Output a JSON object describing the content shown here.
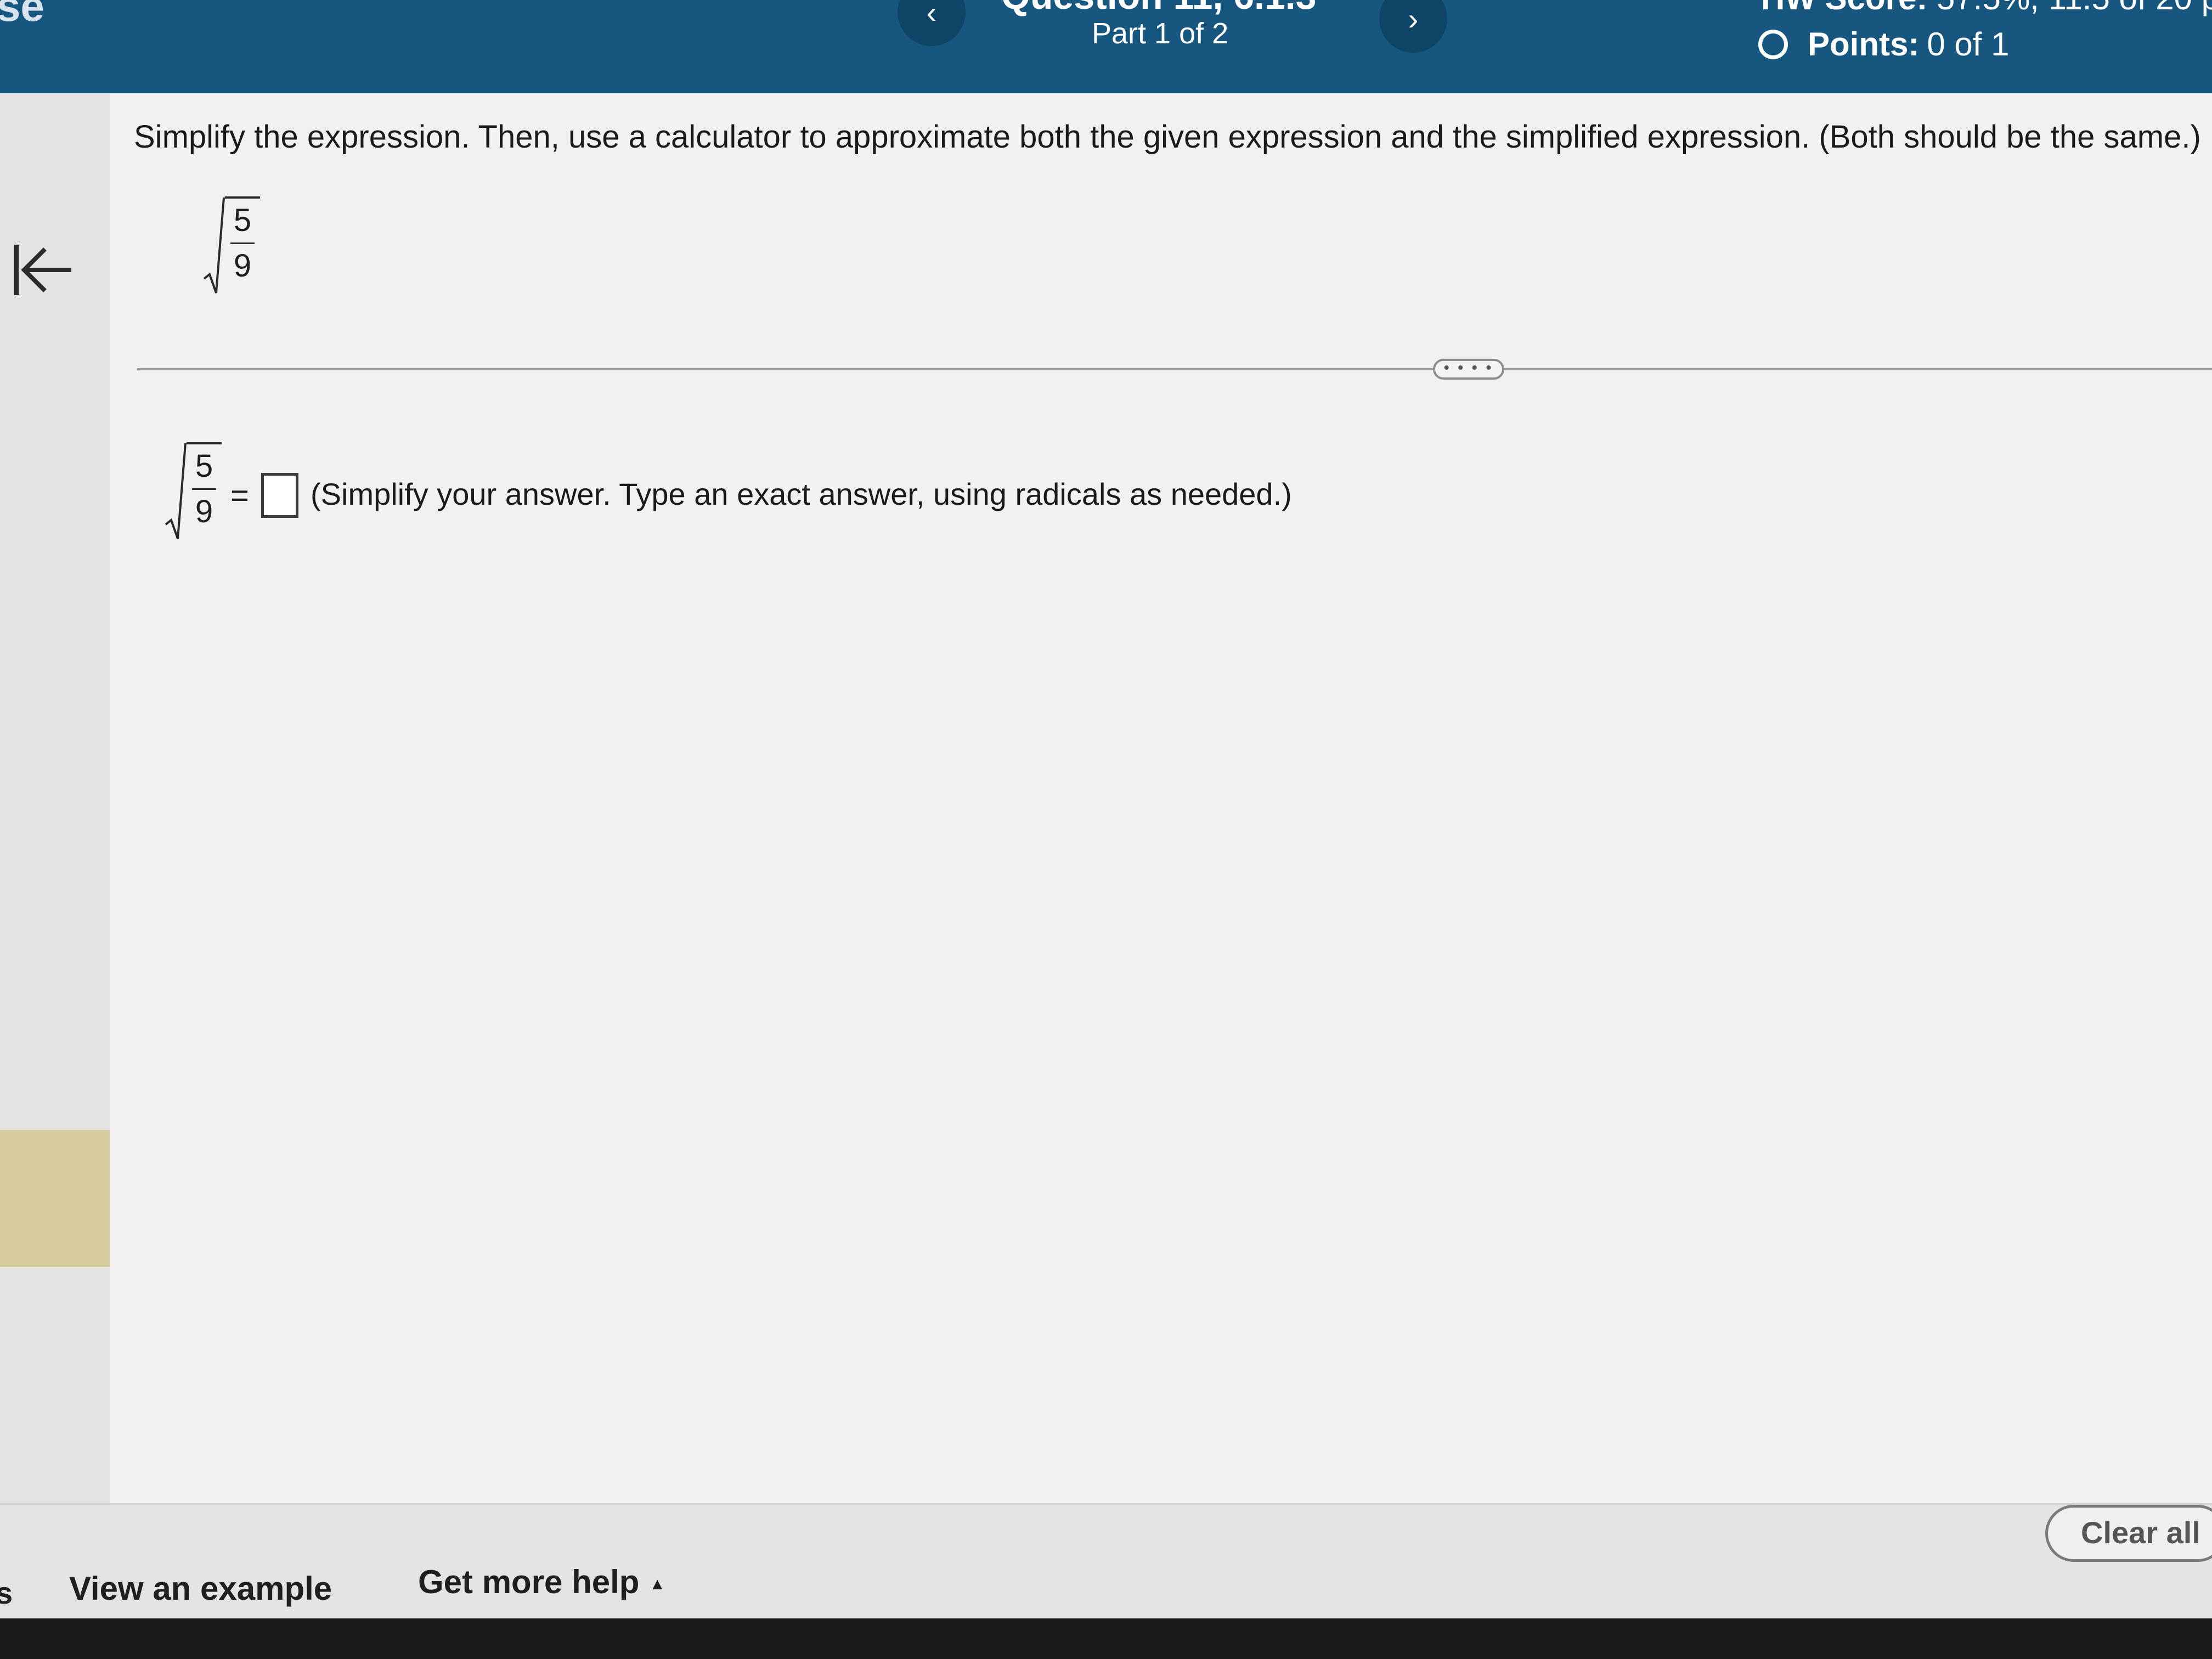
{
  "header": {
    "left_partial_text": "se",
    "question_label": "Question 11, 6.1.3",
    "part_label": "Part 1 of 2",
    "prev_glyph": "‹",
    "next_glyph": "›",
    "hw_score_label": "HW Score:",
    "hw_score_value": "57.5%, 11.5 of 20 p",
    "points_label": "Points:",
    "points_value": "0 of 1"
  },
  "question": {
    "prompt": "Simplify the expression. Then, use a calculator to approximate both the given expression and the simplified expression. (Both should be the same.)",
    "expression": {
      "numerator": "5",
      "denominator": "9"
    },
    "more_button": "• • • •"
  },
  "answer": {
    "expression": {
      "numerator": "5",
      "denominator": "9"
    },
    "equals": "=",
    "input_value": "",
    "note": "(Simplify your answer. Type an exact answer, using radicals as needed.)"
  },
  "footer": {
    "left_partial_text": "s",
    "view_example": "View an example",
    "get_more_help": "Get more help",
    "help_arrow": "▲",
    "clear_all": "Clear all"
  },
  "colors": {
    "header_bg": "#17567f",
    "panel_bg": "#f1f1ef",
    "sidebar_highlight": "#d6ca9f"
  }
}
